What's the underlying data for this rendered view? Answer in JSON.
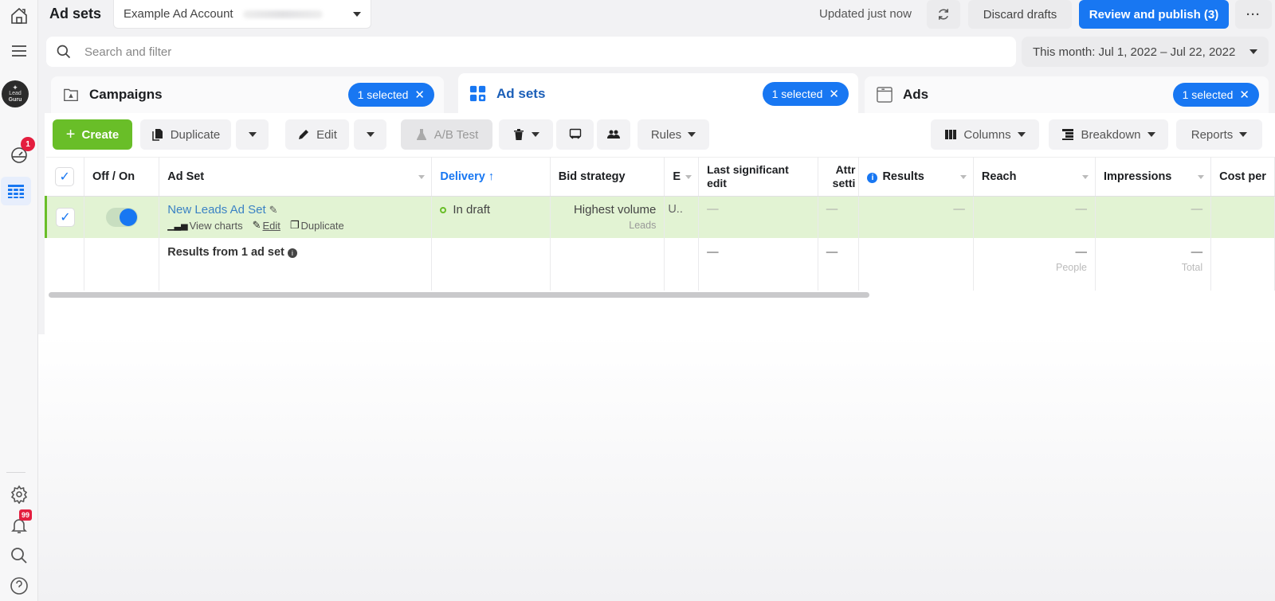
{
  "header": {
    "title": "Ad sets",
    "account_name": "Example Ad Account",
    "updated_text": "Updated just now",
    "discard_label": "Discard drafts",
    "publish_label": "Review and publish (3)",
    "more_label": "···"
  },
  "search": {
    "placeholder": "Search and filter"
  },
  "date_range": "This month: Jul 1, 2022 – Jul 22, 2022",
  "rail": {
    "avatar_line1": "Lead",
    "avatar_line2": "Guru",
    "dashboard_badge": "1",
    "notifications_badge": "99"
  },
  "level_tabs": [
    {
      "label": "Campaigns",
      "chip": "1 selected"
    },
    {
      "label": "Ad sets",
      "chip": "1 selected"
    },
    {
      "label": "Ads",
      "chip": "1 selected"
    }
  ],
  "toolbar": {
    "create": "Create",
    "duplicate": "Duplicate",
    "edit": "Edit",
    "ab_test": "A/B Test",
    "rules": "Rules",
    "columns": "Columns",
    "breakdown": "Breakdown",
    "reports": "Reports"
  },
  "table": {
    "columns": [
      "Off / On",
      "Ad Set",
      "Delivery ↑",
      "Bid strategy",
      "E",
      "Last significant edit",
      "Attr setti",
      "Results",
      "Reach",
      "Impressions",
      "Cost per"
    ],
    "row": {
      "name": "New Leads Ad Set",
      "on": true,
      "actions": [
        "View charts",
        "Edit",
        "Duplicate"
      ],
      "delivery": "In draft",
      "bid_strategy": "Highest volume",
      "bid_sub": "Leads",
      "budget": "U..",
      "last_edit": "—",
      "attr": "—",
      "results": "—",
      "reach": "—",
      "impressions": "—"
    },
    "summary": {
      "label": "Results from 1 ad set",
      "last_edit": "—",
      "attr": "—",
      "reach": "—",
      "reach_sub": "People",
      "impressions": "—",
      "impressions_sub": "Total"
    }
  }
}
